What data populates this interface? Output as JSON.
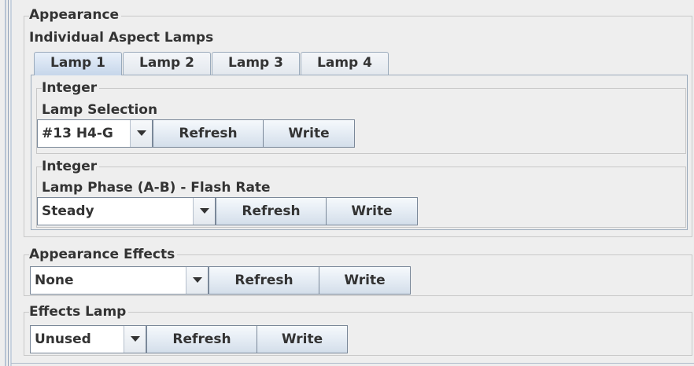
{
  "appearance": {
    "title": "Appearance",
    "subtitle": "Individual Aspect Lamps",
    "tabs": [
      {
        "label": "Lamp 1",
        "selected": true
      },
      {
        "label": "Lamp 2",
        "selected": false
      },
      {
        "label": "Lamp 3",
        "selected": false
      },
      {
        "label": "Lamp 4",
        "selected": false
      }
    ],
    "lamp_selection": {
      "group_title": "Integer",
      "label": "Lamp Selection",
      "value": "#13 H4-G",
      "refresh_label": "Refresh",
      "write_label": "Write"
    },
    "lamp_phase": {
      "group_title": "Integer",
      "label": "Lamp Phase (A-B) - Flash Rate",
      "value": "Steady",
      "refresh_label": "Refresh",
      "write_label": "Write"
    }
  },
  "appearance_effects": {
    "title": "Appearance Effects",
    "value": "None",
    "refresh_label": "Refresh",
    "write_label": "Write"
  },
  "effects_lamp": {
    "title": "Effects Lamp",
    "value": "Unused",
    "refresh_label": "Refresh",
    "write_label": "Write"
  }
}
